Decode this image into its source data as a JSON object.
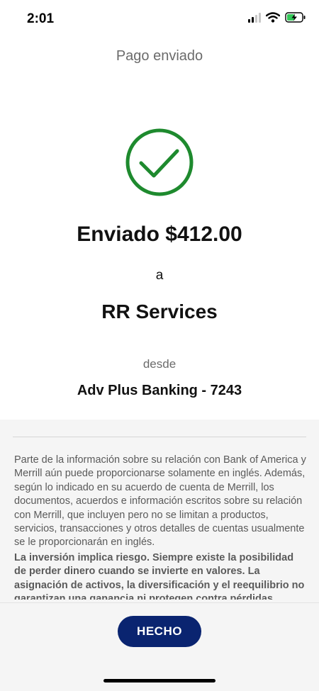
{
  "status_bar": {
    "time": "2:01",
    "icons": [
      "cellular-signal-icon",
      "wifi-icon",
      "battery-charging-icon"
    ]
  },
  "header": {
    "title": "Pago enviado"
  },
  "confirmation": {
    "icon": "success-check-icon",
    "sent_amount": "Enviado $412.00",
    "to_label": "a",
    "payee_name": "RR Services",
    "from_label": "desde",
    "from_account": "Adv Plus Banking - 7243"
  },
  "disclosure": {
    "paragraph": "Parte de la información sobre su relación con Bank of America y Merrill aún puede proporcionarse solamente en inglés. Además, según lo indicado en su acuerdo de cuenta de Merrill, los documentos, acuerdos e información escritos sobre su relación con Merrill, que incluyen pero no se limitan a productos, servicios, transacciones y otros detalles de cuentas usualmente se le proporcionarán en inglés.",
    "warning": "La inversión implica riesgo. Siempre existe la posibilidad de perder dinero cuando se invierte en valores. La asignación de activos, la diversificación y el reequilibrio no garantizan una ganancia ni protegen contra pérdidas"
  },
  "footer": {
    "done_label": "HECHO"
  },
  "colors": {
    "success_green": "#1e8a2e",
    "button_navy": "#0a2470",
    "battery_green": "#34c759"
  }
}
